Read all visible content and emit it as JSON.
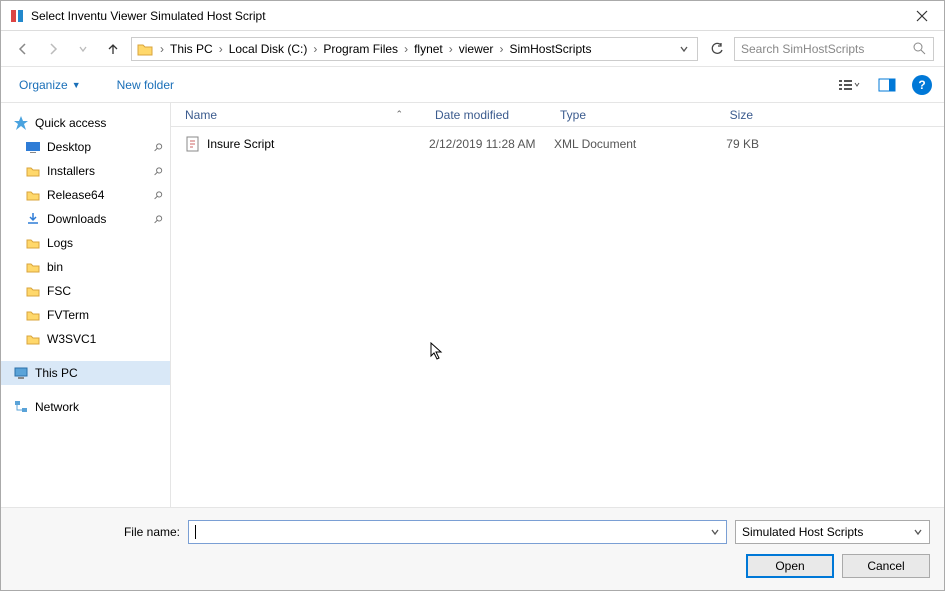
{
  "window": {
    "title": "Select Inventu Viewer Simulated Host Script"
  },
  "breadcrumb": [
    "This PC",
    "Local Disk (C:)",
    "Program Files",
    "flynet",
    "viewer",
    "SimHostScripts"
  ],
  "search": {
    "placeholder": "Search SimHostScripts"
  },
  "toolbar": {
    "organize": "Organize",
    "new_folder": "New folder"
  },
  "sidebar": {
    "quick_access": "Quick access",
    "items": [
      {
        "label": "Desktop",
        "pinned": true,
        "icon": "desktop"
      },
      {
        "label": "Installers",
        "pinned": true,
        "icon": "folder"
      },
      {
        "label": "Release64",
        "pinned": true,
        "icon": "folder"
      },
      {
        "label": "Downloads",
        "pinned": true,
        "icon": "downloads"
      },
      {
        "label": "Logs",
        "pinned": false,
        "icon": "folder"
      },
      {
        "label": "bin",
        "pinned": false,
        "icon": "folder"
      },
      {
        "label": "FSC",
        "pinned": false,
        "icon": "folder"
      },
      {
        "label": "FVTerm",
        "pinned": false,
        "icon": "folder"
      },
      {
        "label": "W3SVC1",
        "pinned": false,
        "icon": "folder"
      }
    ],
    "this_pc": "This PC",
    "network": "Network"
  },
  "columns": {
    "name": "Name",
    "date": "Date modified",
    "type": "Type",
    "size": "Size"
  },
  "files": [
    {
      "name": "Insure Script",
      "date": "2/12/2019 11:28 AM",
      "type": "XML Document",
      "size": "79 KB"
    }
  ],
  "footer": {
    "file_name_label": "File name:",
    "file_name_value": "",
    "filter": "Simulated Host Scripts",
    "open": "Open",
    "cancel": "Cancel"
  },
  "help_glyph": "?"
}
